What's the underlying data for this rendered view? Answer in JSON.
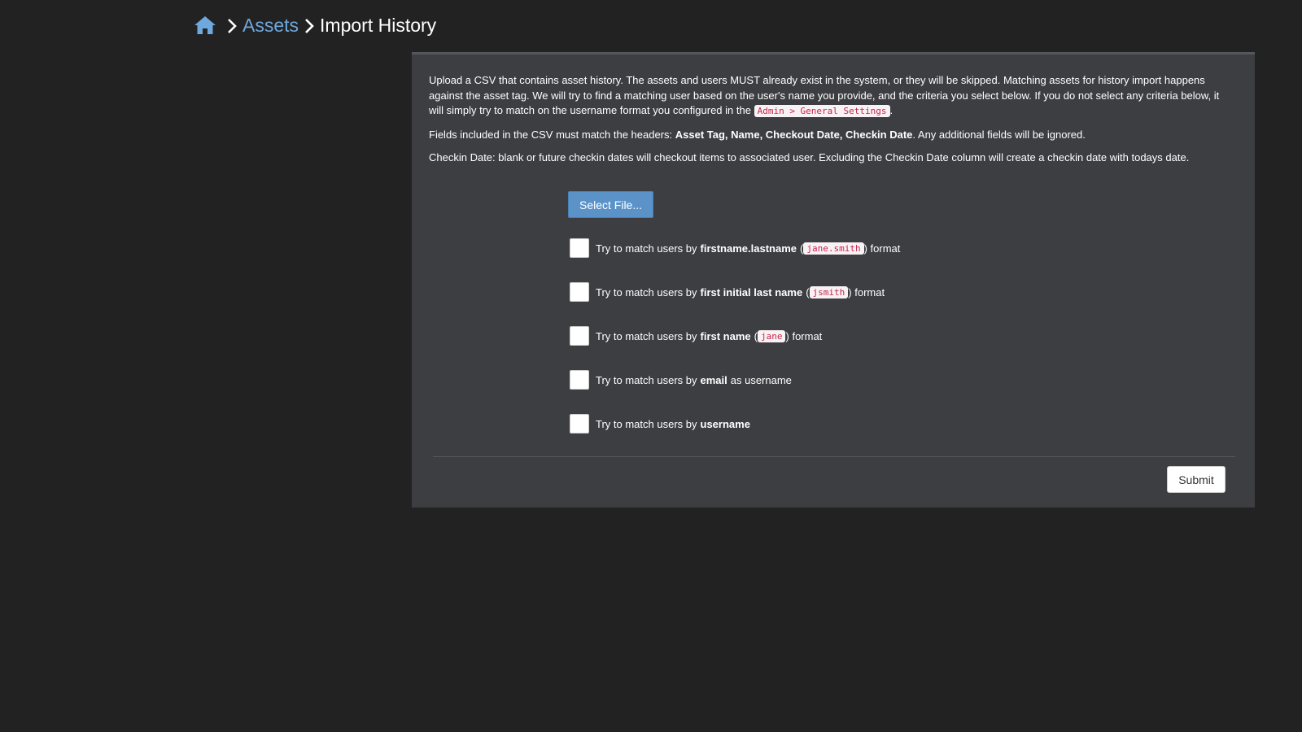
{
  "breadcrumb": {
    "home_icon": "home-icon",
    "assets_label": "Assets",
    "current_label": "Import History"
  },
  "intro": {
    "p1_a": "Upload a CSV that contains asset history. The assets and users MUST already exist in the system, or they will be skipped. Matching assets for history import happens against the asset tag. We will try to find a matching user based on the user's name you provide, and the criteria you select below. If you do not select any criteria below, it will simply try to match on the username format you configured in the ",
    "p1_code": "Admin > General Settings",
    "p1_b": ".",
    "p2_a": "Fields included in the CSV must match the headers: ",
    "p2_bold": "Asset Tag, Name, Checkout Date, Checkin Date",
    "p2_b": ". Any additional fields will be ignored.",
    "p3": "Checkin Date: blank or future checkin dates will checkout items to associated user. Excluding the Checkin Date column will create a checkin date with todays date."
  },
  "select_file_label": "Select File...",
  "options": [
    {
      "prefix": "Try to match users by",
      "bold": "firstname.lastname",
      "open": "(",
      "code": "jane.smith",
      "close": ")",
      "suffix": "format"
    },
    {
      "prefix": "Try to match users by",
      "bold": "first initial last name",
      "open": "(",
      "code": "jsmith",
      "close": ")",
      "suffix": "format"
    },
    {
      "prefix": "Try to match users by",
      "bold": "first name",
      "open": "(",
      "code": "jane",
      "close": ")",
      "suffix": "format"
    },
    {
      "prefix": "Try to match users by",
      "bold": "email",
      "suffix": "as username"
    },
    {
      "prefix": "Try to match users by",
      "bold": "username"
    }
  ],
  "submit_label": "Submit",
  "colors": {
    "background": "#222222",
    "panel": "#3d3e42",
    "link": "#6fa8dc",
    "primary_button": "#5b93c9",
    "code_text": "#c7254e"
  }
}
